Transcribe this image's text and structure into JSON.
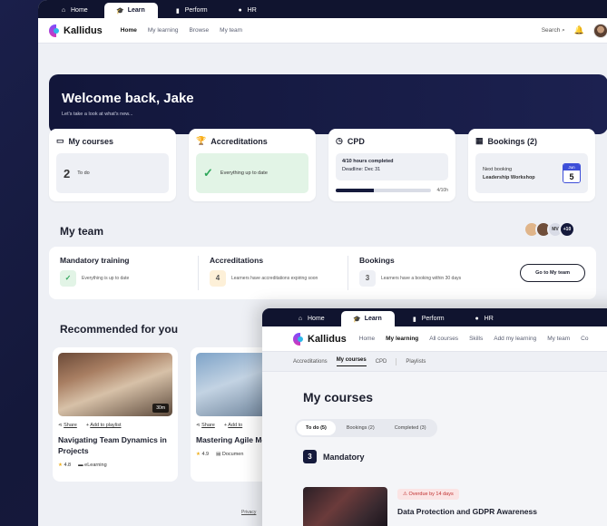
{
  "back": {
    "topbar": {
      "tabs": [
        "Home",
        "Learn",
        "Perform",
        "HR"
      ],
      "active": "Learn"
    },
    "brand": "Kallidus",
    "nav": {
      "links": [
        "Home",
        "My learning",
        "Browse",
        "My team"
      ],
      "active": "Home",
      "search": "Search"
    },
    "hero": {
      "title": "Welcome back, Jake",
      "subtitle": "Let's take a look at what's new..."
    },
    "cards": {
      "my_courses": {
        "title": "My courses",
        "count": "2",
        "label": "To do"
      },
      "accreditations": {
        "title": "Accreditations",
        "status": "Everything up to date"
      },
      "cpd": {
        "title": "CPD",
        "hours": "4/10 hours completed",
        "deadline": "Deadline: Dec 31",
        "progress_label": "4/10h",
        "progress": 0.4
      },
      "bookings": {
        "title": "Bookings (2)",
        "next_label": "Next booking",
        "next_name": "Leadership Workshop",
        "cal_month": "Jun",
        "cal_day": "5"
      }
    },
    "team": {
      "title": "My team",
      "avatars_extra": "+10",
      "avatar_initials": "MV",
      "mandatory": {
        "title": "Mandatory training",
        "status": "Everything is up to date"
      },
      "accreditations": {
        "title": "Accreditations",
        "count": "4",
        "status": "Learners have accreditations expiring soon"
      },
      "bookings": {
        "title": "Bookings",
        "count": "3",
        "status": "Learners have a booking within 30 days"
      },
      "button": "Go to My team"
    },
    "recommended": {
      "title": "Recommended for you",
      "courses": [
        {
          "title": "Navigating Team Dynamics in Projects",
          "duration": "30m",
          "rating": "4.8",
          "type": "eLearning",
          "share": "Share",
          "playlist": "Add to playlist"
        },
        {
          "title": "Mastering Agile Methodologies",
          "rating": "4.9",
          "type": "Documen",
          "share": "Share",
          "playlist": "Add to"
        }
      ]
    },
    "privacy": "Privacy"
  },
  "front": {
    "topbar": {
      "tabs": [
        "Home",
        "Learn",
        "Perform",
        "HR"
      ],
      "active": "Learn"
    },
    "brand": "Kallidus",
    "nav": {
      "links": [
        "Home",
        "My learning",
        "All courses",
        "Skills",
        "Add my learning",
        "My team",
        "Co"
      ],
      "active": "My learning"
    },
    "subnav": {
      "items": [
        "Accreditations",
        "My courses",
        "CPD",
        "Playlists"
      ],
      "active": "My courses"
    },
    "title": "My courses",
    "tabs": [
      "To do (5)",
      "Bookings (2)",
      "Completed (3)"
    ],
    "section": {
      "count": "3",
      "label": "Mandatory"
    },
    "course": {
      "badge": "Overdue by 14 days",
      "title": "Data Protection and GDPR Awareness"
    }
  },
  "colors": {
    "navy": "#10142f",
    "accent": "#3d4ed8",
    "success": "#2ea65a",
    "danger": "#c13131"
  }
}
